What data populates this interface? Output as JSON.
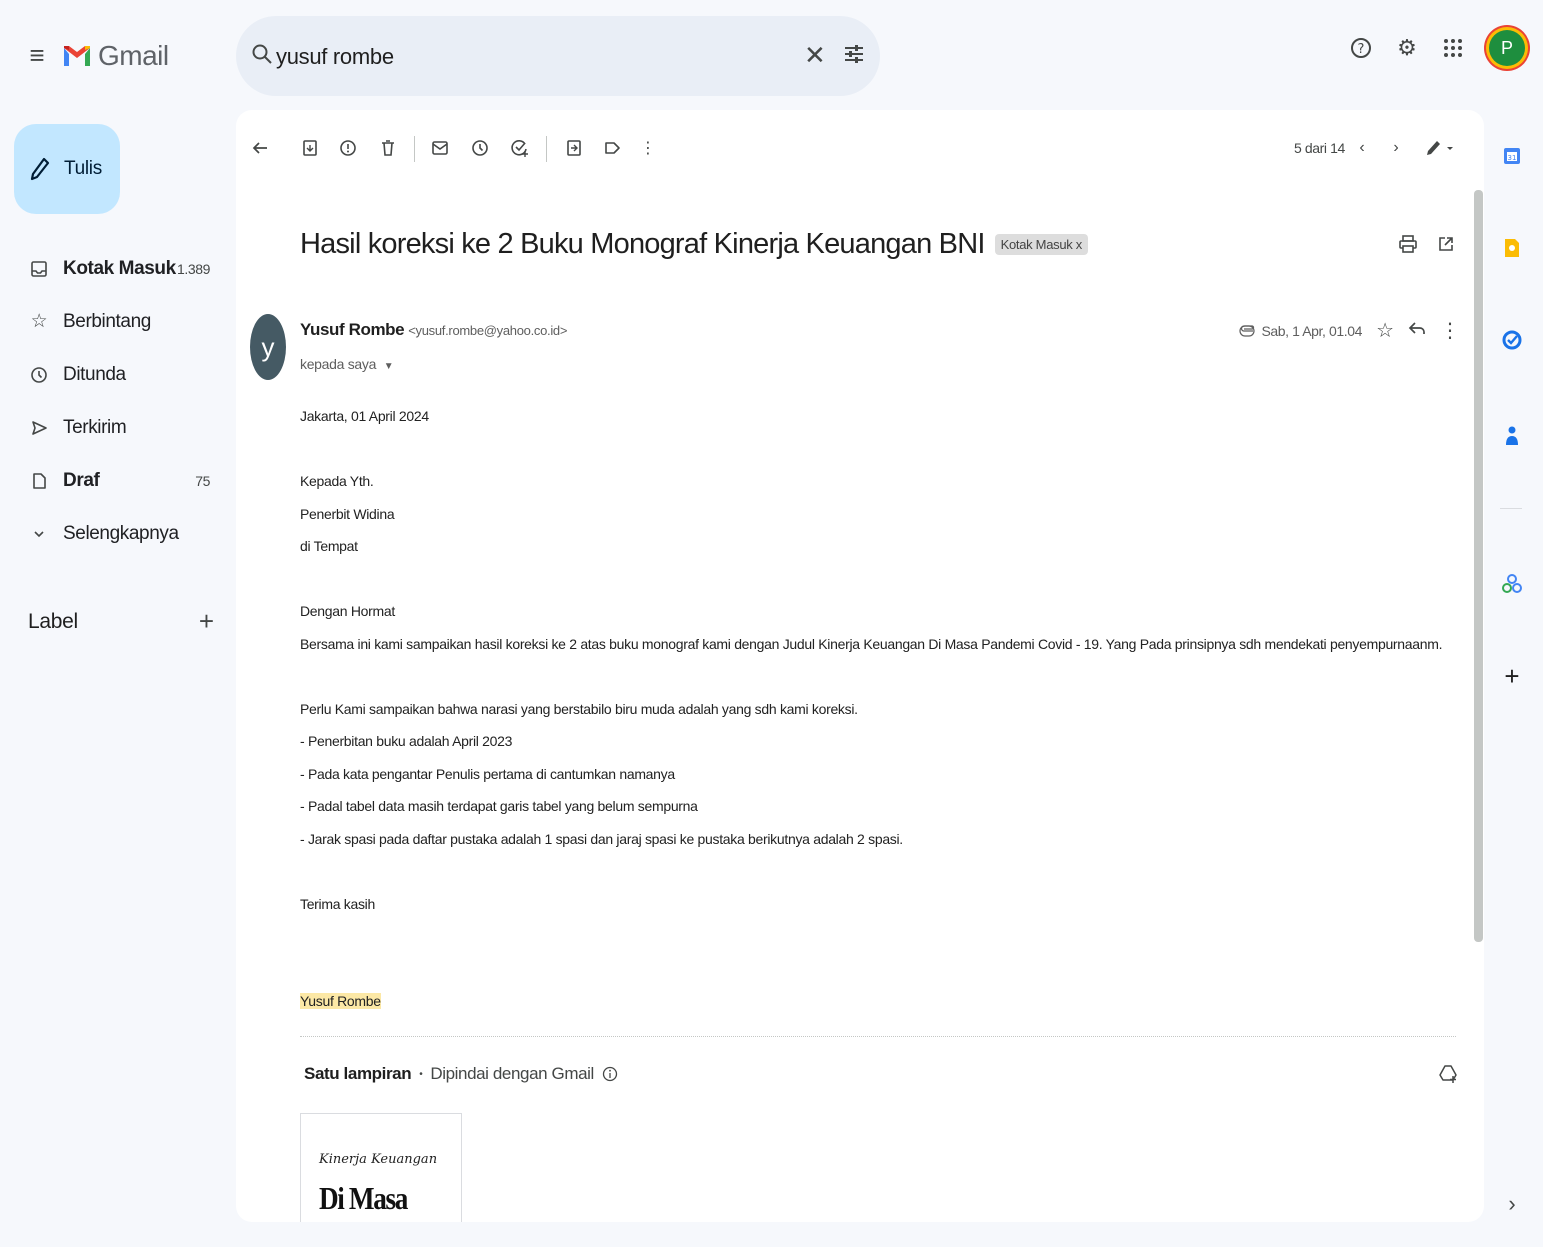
{
  "app": {
    "name": "Gmail"
  },
  "search": {
    "query": "yusuf rombe"
  },
  "compose": {
    "label": "Tulis"
  },
  "nav": [
    {
      "label": "Kotak Masuk",
      "count": "1.389",
      "bold": true,
      "icon": "inbox-icon"
    },
    {
      "label": "Berbintang",
      "count": "",
      "bold": false,
      "icon": "star-icon"
    },
    {
      "label": "Ditunda",
      "count": "",
      "bold": false,
      "icon": "clock-icon"
    },
    {
      "label": "Terkirim",
      "count": "",
      "bold": false,
      "icon": "send-icon"
    },
    {
      "label": "Draf",
      "count": "75",
      "bold": true,
      "icon": "draft-icon"
    },
    {
      "label": "Selengkapnya",
      "count": "",
      "bold": false,
      "icon": "chevron-down-icon"
    }
  ],
  "labels": {
    "title": "Label"
  },
  "toolbar": {
    "pager": "5 dari 14"
  },
  "email": {
    "subject": "Hasil koreksi ke 2 Buku Monograf Kinerja Keuangan BNI",
    "chip": "Kotak Masuk",
    "chip_close": "x",
    "sender_initial": "y",
    "sender_name": "Yusuf Rombe",
    "sender_email": "<yusuf.rombe@yahoo.co.id>",
    "to": "kepada saya",
    "date": "Sab, 1 Apr, 01.04",
    "body": [
      "Jakarta, 01 April 2024",
      "",
      "Kepada Yth.",
      "Penerbit Widina",
      "di Tempat",
      "",
      "Dengan Hormat",
      "Bersama ini kami sampaikan hasil koreksi ke 2 atas buku monograf kami dengan Judul Kinerja Keuangan Di Masa Pandemi Covid - 19. Yang Pada prinsipnya sdh mendekati penyempurnaanm.",
      "",
      "Perlu Kami sampaikan bahwa narasi yang berstabilo biru muda adalah yang sdh kami koreksi.",
      "-  Penerbitan buku adalah April 2023",
      "-  Pada kata pengantar Penulis pertama di cantumkan namanya",
      "- Padal tabel data masih terdapat garis tabel yang belum sempurna",
      "- Jarak spasi pada daftar pustaka adalah 1 spasi dan jaraj spasi ke pustaka berikutnya adalah 2 spasi.",
      "",
      "Terima kasih",
      "",
      ""
    ],
    "signature": "Yusuf Rombe"
  },
  "attachments": {
    "title": "Satu lampiran",
    "separator": "•",
    "scanned": "Dipindai dengan Gmail",
    "thumb_line1": "Kinerja Keuangan",
    "thumb_line2": "Di Masa Pandemi"
  },
  "colors": {
    "compose_bg": "#c2e7ff",
    "search_bg": "#e9eef6",
    "page_bg": "#f6f8fc",
    "highlight": "#fce8a6"
  }
}
